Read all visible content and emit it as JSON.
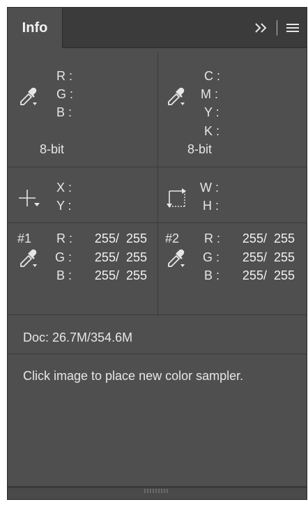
{
  "tab": {
    "label": "Info"
  },
  "header_icons": [
    "double-chevron-right-icon",
    "menu-icon"
  ],
  "rgb_block": {
    "labels": [
      "R :",
      "G :",
      "B :"
    ],
    "bits": "8-bit",
    "icon": "eyedropper-icon"
  },
  "cmyk_block": {
    "labels": [
      "C :",
      "M :",
      "Y :",
      "K :"
    ],
    "bits": "8-bit",
    "icon": "eyedropper-icon"
  },
  "xy_block": {
    "labels": [
      "X :",
      "Y :"
    ],
    "icon": "crosshair-icon"
  },
  "wh_block": {
    "labels": [
      "W :",
      "H :"
    ],
    "icon": "selection-size-icon"
  },
  "sampler1": {
    "id": "#1",
    "rows": [
      {
        "label": "R :",
        "value": "255/  255"
      },
      {
        "label": "G :",
        "value": "255/  255"
      },
      {
        "label": "B :",
        "value": "255/  255"
      }
    ]
  },
  "sampler2": {
    "id": "#2",
    "rows": [
      {
        "label": "R :",
        "value": "255/  255"
      },
      {
        "label": "G :",
        "value": "255/  255"
      },
      {
        "label": "B :",
        "value": "255/  255"
      }
    ]
  },
  "doc": {
    "label": "Doc: 26.7M/354.6M"
  },
  "hint": {
    "text": "Click image to place new color sampler."
  },
  "colors": {
    "panel_bg": "#4f4f4f",
    "tabbar_bg": "#3b3b3b",
    "text": "#e6e6e6"
  }
}
